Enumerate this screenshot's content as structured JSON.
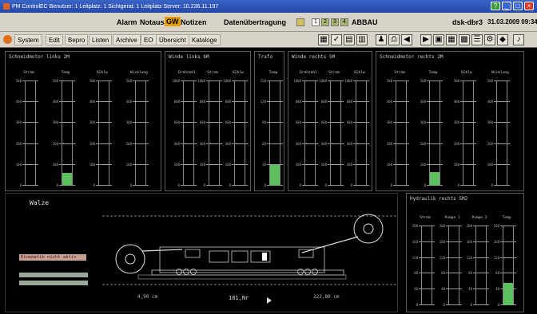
{
  "window": {
    "title": "PM ControlEC  Benutzer: 1 Leitplatz: 1  Sichtgerat: 1  Leitplatz Server: 10.236.11.197"
  },
  "status": {
    "alarm": "Alarm",
    "notaus": "Notaus",
    "gw": "GW",
    "notizen": "Notizen",
    "daten": "Datenübertragung",
    "ind1": "1",
    "ind2": "2",
    "ind3": "3",
    "ind4": "4",
    "abbau": "ABBAU",
    "host": "dsk-dbr3",
    "datetime": "31.03.2009 09:34"
  },
  "menu": {
    "items": [
      "System",
      "Edit",
      "Bepro",
      "Listen",
      "Archive",
      "EO",
      "Übersicht",
      "Kataloge"
    ]
  },
  "panels": {
    "schneidmotor_links": {
      "title": "Schneidmotor links 2M",
      "columns": [
        "Strom",
        "Temp",
        "Kühlw",
        "Wicklung"
      ],
      "ticks": [
        "500",
        "400",
        "300",
        "200",
        "100",
        "0"
      ],
      "fill": 0.12
    },
    "winde_links": {
      "title": "Winde links 6M",
      "columns": [
        "Drehzahl",
        "Strom",
        "Kühlw"
      ],
      "ticks": [
        "1000",
        "800",
        "600",
        "400",
        "200",
        "0"
      ]
    },
    "trafo": {
      "title": "Trafo",
      "columns": [
        "Temp"
      ],
      "ticks": [
        "150",
        "120",
        "90",
        "60",
        "30",
        "0"
      ],
      "fill": 0.2
    },
    "winde_rechts": {
      "title": "Winde rechts 5M",
      "columns": [
        "Drehzahl",
        "Strom",
        "Kühlw"
      ],
      "ticks": [
        "1000",
        "800",
        "600",
        "400",
        "200",
        "0"
      ]
    },
    "schneidmotor_rechts": {
      "title": "Schneidmotor rechts 2M",
      "columns": [
        "Strom",
        "Temp",
        "Kühlw",
        "Wicklung"
      ],
      "ticks": [
        "500",
        "400",
        "300",
        "200",
        "100",
        "0"
      ],
      "fill": 0.13
    },
    "hydraulik_rechts": {
      "title": "Hydraulik rechts 5M2",
      "columns": [
        "Strom",
        "Pumpe 1",
        "Pumpe 2",
        "Temp"
      ],
      "ticks": [
        "200",
        "160",
        "120",
        "80",
        "40",
        "0"
      ],
      "fill": 0.28
    }
  },
  "walze": {
    "title": "Walze",
    "alert": "Einematik nicht aktiv",
    "pos_left": "4,90 cm",
    "pos_right": "222,80 cm",
    "speed": "181,Nr"
  },
  "colors": {
    "fill": "#5cc05c",
    "titlebar": "#2448a8",
    "chrome": "#d7d3c8",
    "gw": "#e8a000"
  }
}
